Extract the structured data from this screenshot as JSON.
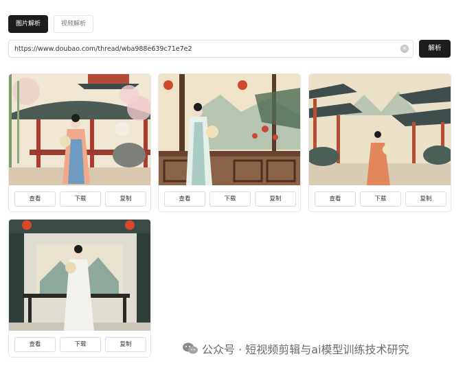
{
  "tabs": [
    {
      "label": "图片解析",
      "active": true
    },
    {
      "label": "视频解析",
      "active": false
    }
  ],
  "url_input": {
    "value": "https://www.doubao.com/thread/wba988e639c71e7e2"
  },
  "parse_button": {
    "label": "解析"
  },
  "card_buttons": {
    "view": "查看",
    "download": "下载",
    "copy": "复制"
  },
  "cards": [
    {
      "scene": "pavilion with blossom trees, woman in red and blue hanfu holding fan"
    },
    {
      "scene": "woman in pale hanfu holding fan on balcony with lanterns"
    },
    {
      "scene": "woman in orange hanfu before pagoda roofs and misty mountains"
    },
    {
      "scene": "woman in white hanfu with fan beside painted screen and table"
    }
  ],
  "watermark": {
    "text": "公众号 · 短视频剪辑与ai模型训练技术研究"
  }
}
